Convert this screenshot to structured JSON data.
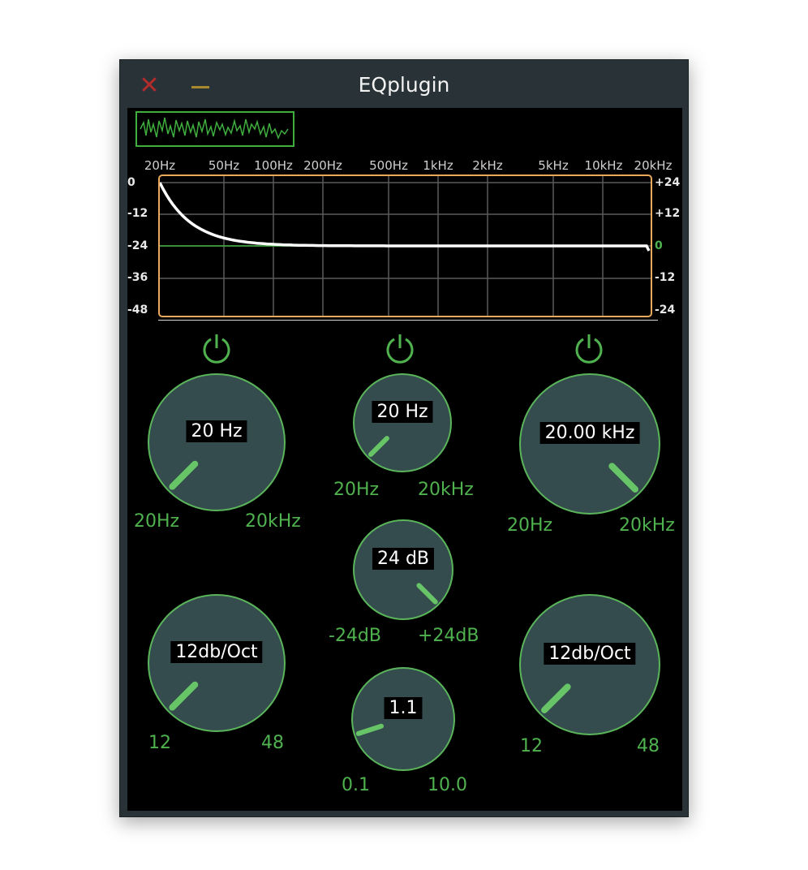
{
  "window": {
    "title": "EQplugin",
    "close_glyph": "✕"
  },
  "response_graph": {
    "freq_labels": [
      "20Hz",
      "50Hz",
      "100Hz",
      "200Hz",
      "500Hz",
      "1kHz",
      "2kHz",
      "5kHz",
      "10kHz",
      "20kHz"
    ],
    "left_db_labels": [
      "0",
      "-12",
      "-24",
      "-36",
      "-48"
    ],
    "right_db_labels": [
      "+24",
      "+12",
      "0",
      "-12",
      "-24"
    ],
    "curve_color": "#ffffff",
    "zero_line_color": "#3fae3f",
    "border_color": "#e8a95b"
  },
  "bands": {
    "left": {
      "power_icon": "power-icon",
      "frequency": {
        "value": "20 Hz",
        "min": "20Hz",
        "max": "20kHz",
        "position": 0.0
      },
      "slope": {
        "value": "12db/Oct",
        "min": "12",
        "max": "48",
        "position": 0.0
      }
    },
    "middle": {
      "power_icon": "power-icon",
      "frequency": {
        "value": "20 Hz",
        "min": "20Hz",
        "max": "20kHz",
        "position": 0.0
      },
      "gain": {
        "value": "24 dB",
        "min": "-24dB",
        "max": "+24dB",
        "position": 1.0
      },
      "q": {
        "value": "1.1",
        "min": "0.1",
        "max": "10.0",
        "position": 0.1
      }
    },
    "right": {
      "power_icon": "power-icon",
      "frequency": {
        "value": "20.00 kHz",
        "min": "20Hz",
        "max": "20kHz",
        "position": 1.0
      },
      "slope": {
        "value": "12db/Oct",
        "min": "12",
        "max": "48",
        "position": 0.0
      }
    }
  },
  "colors": {
    "knob_fill": "#354c4e",
    "knob_stroke": "#5ab55a",
    "indicator": "#67c567",
    "accent_green": "#4fb24f",
    "close_red": "#b32b2b",
    "minimize_gold": "#a8882c"
  }
}
